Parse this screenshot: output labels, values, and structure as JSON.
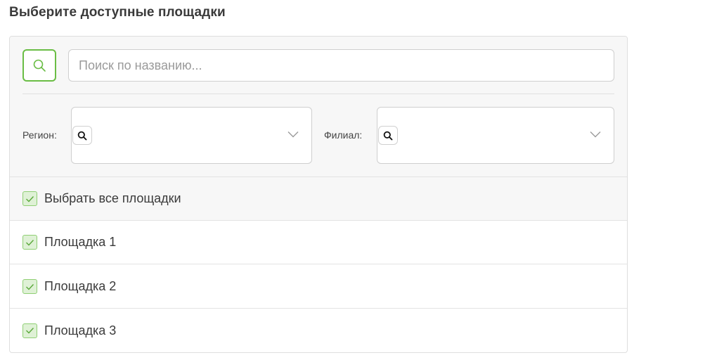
{
  "page": {
    "title": "Выберите доступные площадки"
  },
  "search": {
    "placeholder": "Поиск по названию..."
  },
  "filters": {
    "region_label": "Регион:",
    "branch_label": "Филиал:"
  },
  "select_all": {
    "label": "Выбрать все площадки",
    "checked": true
  },
  "sites": [
    {
      "label": "Площадка 1",
      "checked": true
    },
    {
      "label": "Площадка 2",
      "checked": true
    },
    {
      "label": "Площадка 3",
      "checked": true
    }
  ],
  "colors": {
    "accent": "#6abd45",
    "checkbox_fill": "#dff1d6",
    "panel_bg": "#f7f7f7"
  },
  "icons": {
    "search": "search-icon",
    "dropdown": "chevron-down-icon",
    "check": "check-icon"
  }
}
